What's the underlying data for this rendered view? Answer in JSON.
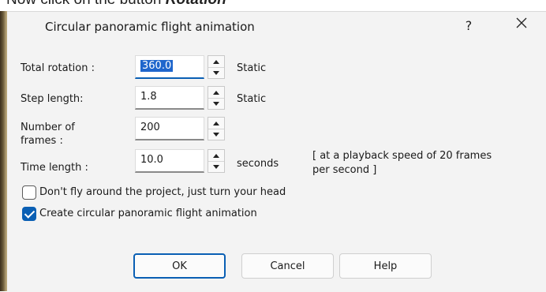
{
  "caption": {
    "prefix": "Now click on the button ",
    "emphasis": "Rotation",
    "suffix": ""
  },
  "dialog": {
    "title": "Circular panoramic flight animation",
    "help_glyph": "?",
    "close_glyph": "✕"
  },
  "fields": {
    "total_rotation": {
      "label": "Total rotation :",
      "value": "360.0",
      "unit": "Static"
    },
    "step_length": {
      "label": "Step length:",
      "value": "1.8",
      "unit": "Static"
    },
    "number_of_frames": {
      "label_line1": "Number of",
      "label_line2": "frames :",
      "value": "200"
    },
    "time_length": {
      "label": "Time length :",
      "value": "10.0",
      "unit": "seconds"
    }
  },
  "playback_note": {
    "line1": "[ at a playback speed of 20 frames",
    "line2": "per second ]"
  },
  "options": {
    "turn_head": {
      "label": "Don't fly around the project, just turn your head",
      "checked": false
    },
    "create_animation": {
      "label": "Create circular panoramic flight animation",
      "checked": true
    }
  },
  "buttons": {
    "ok": "OK",
    "cancel": "Cancel",
    "help": "Help"
  },
  "colors": {
    "accent": "#0a5fb4",
    "dialog_bg": "#f3f3f3"
  }
}
